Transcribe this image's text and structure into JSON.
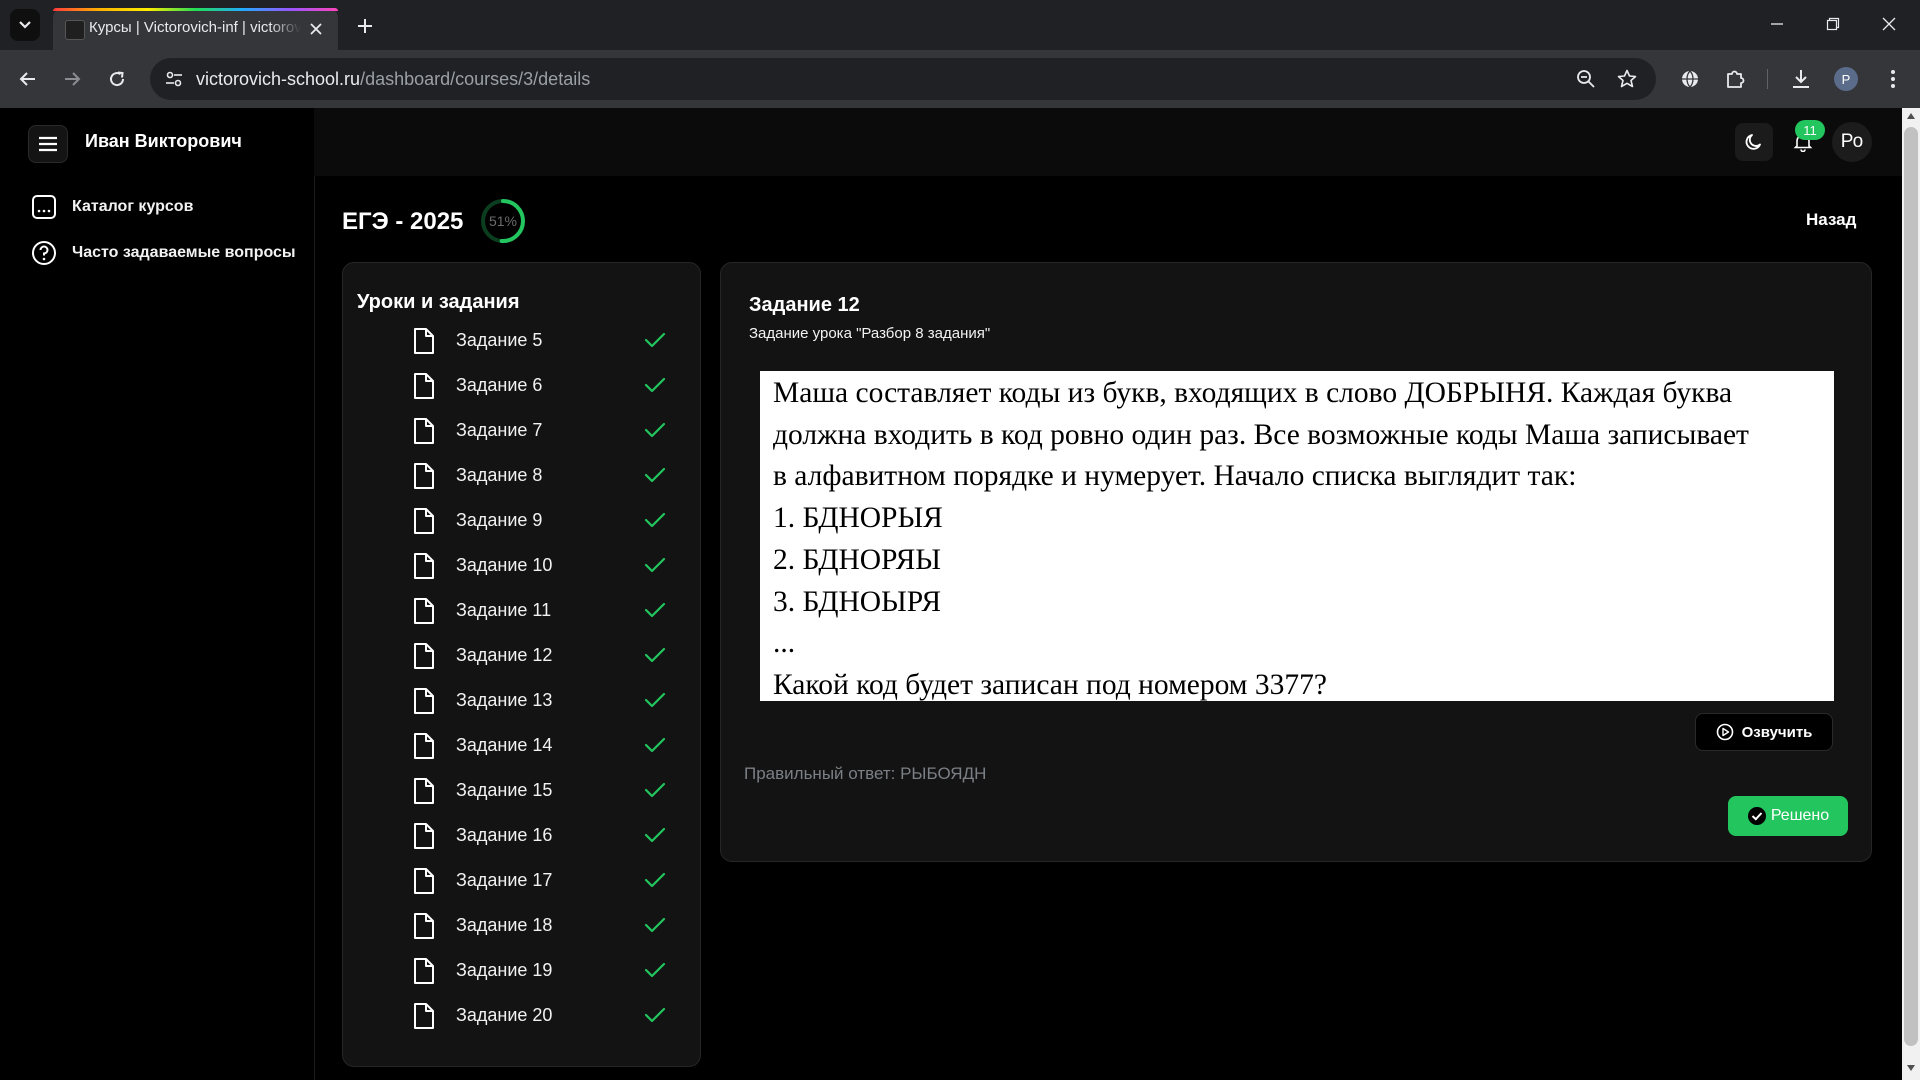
{
  "browser": {
    "tab_title": "Курсы | Victorovich-inf | victorovich-school.ru",
    "url_host": "victorovich-school.ru",
    "url_path": "/dashboard/courses/3/details",
    "profile_initial": "P"
  },
  "app": {
    "user_name": "Иван Викторович",
    "avatar_initials": "Ро",
    "notifications_count": "11",
    "sidebar": {
      "items": [
        {
          "label": "Каталог курсов",
          "icon": "catalog-icon"
        },
        {
          "label": "Часто задаваемые вопросы",
          "icon": "help-circle-icon"
        }
      ]
    },
    "course": {
      "title": "ЕГЭ - 2025",
      "progress_text": "51%",
      "progress_value": 0.51,
      "back_label": "Назад"
    },
    "lessons": {
      "title": "Уроки и задания",
      "items": [
        {
          "label": "Задание 5",
          "done": true
        },
        {
          "label": "Задание 6",
          "done": true
        },
        {
          "label": "Задание 7",
          "done": true
        },
        {
          "label": "Задание 8",
          "done": true
        },
        {
          "label": "Задание 9",
          "done": true
        },
        {
          "label": "Задание 10",
          "done": true
        },
        {
          "label": "Задание 11",
          "done": true
        },
        {
          "label": "Задание 12",
          "done": true
        },
        {
          "label": "Задание 13",
          "done": true
        },
        {
          "label": "Задание 14",
          "done": true
        },
        {
          "label": "Задание 15",
          "done": true
        },
        {
          "label": "Задание 16",
          "done": true
        },
        {
          "label": "Задание 17",
          "done": true
        },
        {
          "label": "Задание 18",
          "done": true
        },
        {
          "label": "Задание 19",
          "done": true
        },
        {
          "label": "Задание 20",
          "done": true
        }
      ]
    },
    "task": {
      "title": "Задание 12",
      "subtitle": "Задание урока \"Разбор 8 задания\"",
      "lines": [
        "Маша составляет коды из букв, входящих в слово ДОБРЫНЯ. Каждая буква",
        "должна входить в код ровно один раз. Все возможные коды Маша записывает",
        "в алфавитном порядке и нумерует. Начало списка выглядит так:",
        "1. БДНОРЫЯ",
        "2. БДНОРЯЫ",
        "3. БДНОЫРЯ",
        "...",
        "Какой код будет записан под номером 3377?"
      ],
      "speak_label": "Озвучить",
      "answer_text": "Правильный ответ: РЫБОЯДН",
      "solved_label": "Решено"
    }
  },
  "colors": {
    "accent_green": "#22c55e",
    "panel_bg": "#131313",
    "page_bg": "#000000"
  }
}
